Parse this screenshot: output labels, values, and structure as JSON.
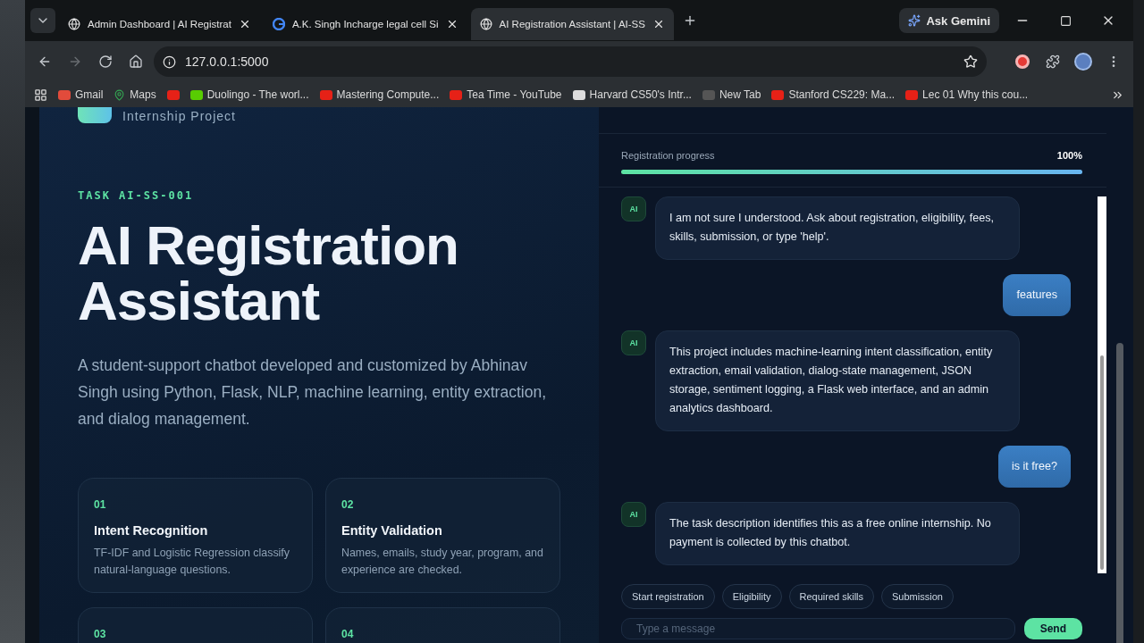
{
  "browser": {
    "tabs": [
      {
        "title": "Admin Dashboard | AI Registrat",
        "kind": "globe",
        "selected": false
      },
      {
        "title": "A.K. Singh Incharge legal cell Si",
        "kind": "google",
        "selected": false
      },
      {
        "title": "AI Registration Assistant | AI-SS",
        "kind": "globe",
        "selected": true
      }
    ],
    "ask_gemini": "Ask Gemini",
    "url": "127.0.0.1:5000",
    "bookmarks": [
      {
        "label": "Gmail",
        "kind": "gmail"
      },
      {
        "label": "Maps",
        "kind": "maps"
      },
      {
        "kind": "youtube"
      },
      {
        "label": "Duolingo - The worl...",
        "kind": "duolingo"
      },
      {
        "label": "Mastering Compute...",
        "kind": "youtube"
      },
      {
        "label": "Tea Time - YouTube",
        "kind": "youtube"
      },
      {
        "label": "Harvard CS50's Intr...",
        "kind": "harvard"
      },
      {
        "label": "New Tab",
        "kind": "blank"
      },
      {
        "label": "Stanford CS229: Ma...",
        "kind": "youtube"
      },
      {
        "label": "Lec 01 Why this cou...",
        "kind": "youtube"
      }
    ]
  },
  "hero": {
    "subtitle": "Internship Project",
    "task": "TASK AI-SS-001",
    "title": "AI Registration Assistant",
    "description": "A student-support chatbot developed and customized by Abhinav Singh using Python, Flask, NLP, machine learning, entity extraction, and dialog management."
  },
  "features": [
    {
      "number": "01",
      "title": "Intent Recognition",
      "description": "TF-IDF and Logistic Regression classify natural-language questions."
    },
    {
      "number": "02",
      "title": "Entity Validation",
      "description": "Names, emails, study year, program, and experience are checked."
    },
    {
      "number": "03"
    },
    {
      "number": "04"
    }
  ],
  "chat": {
    "progress": {
      "label": "Registration progress",
      "value": "100%",
      "level": 1
    },
    "messages": [
      {
        "kind": "ai",
        "avatar": "AI",
        "text": "I am not sure I understood. Ask about registration, eligibility, fees, skills, submission, or type 'help'."
      },
      {
        "kind": "user",
        "text": "features"
      },
      {
        "kind": "ai",
        "avatar": "AI",
        "text": "This project includes machine-learning intent classification, entity extraction, email validation, dialog-state management, JSON storage, sentiment logging, a Flask web interface, and an admin analytics dashboard."
      },
      {
        "kind": "user",
        "text": "is it free?"
      },
      {
        "kind": "ai",
        "avatar": "AI",
        "text": "The task description identifies this as a free online internship. No payment is collected by this chatbot."
      }
    ],
    "quick_replies": [
      "Start registration",
      "Eligibility",
      "Required skills",
      "Submission"
    ],
    "input": {
      "placeholder": "Type a message"
    },
    "send": "Send"
  }
}
